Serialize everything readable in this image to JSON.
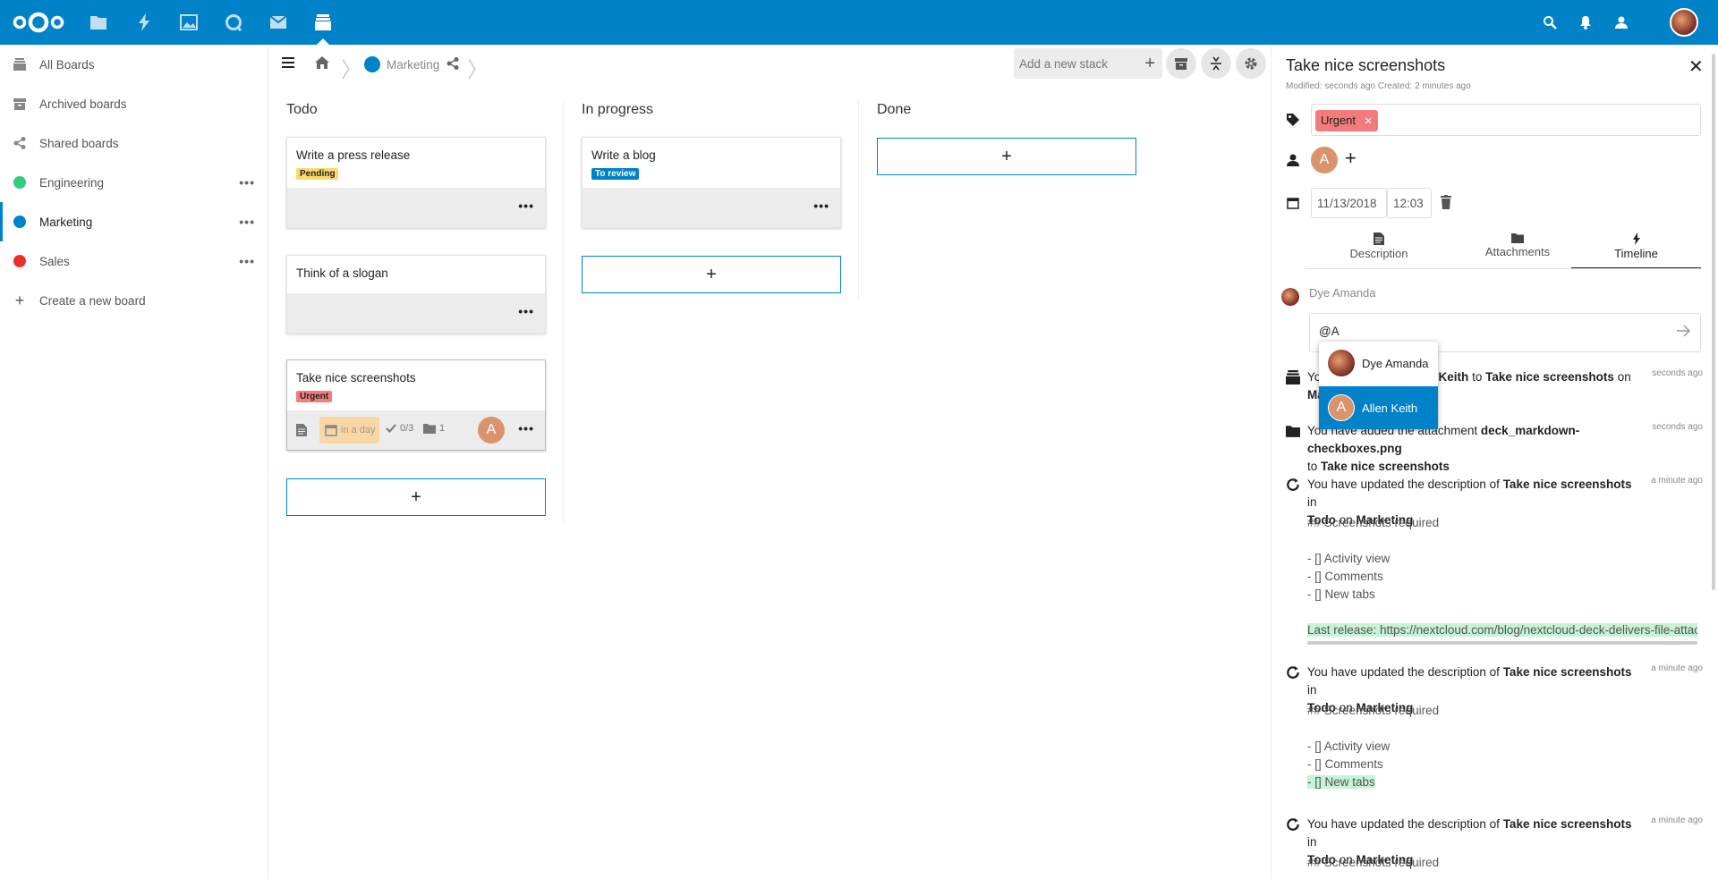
{
  "sidebar": {
    "items": [
      {
        "label": "All Boards"
      },
      {
        "label": "Archived boards"
      },
      {
        "label": "Shared boards"
      },
      {
        "label": "Engineering",
        "color": "#31cc7c"
      },
      {
        "label": "Marketing",
        "color": "#0082c9"
      },
      {
        "label": "Sales",
        "color": "#e9322d"
      },
      {
        "label": "Create a new board"
      }
    ]
  },
  "board": {
    "name": "Marketing",
    "color": "#0082c9",
    "add_stack_placeholder": "Add a new stack"
  },
  "stacks": [
    {
      "title": "Todo",
      "cards": [
        {
          "title": "Write a press release",
          "label": "Pending",
          "label_color": "#fbd96e"
        },
        {
          "title": "Think of a slogan"
        },
        {
          "title": "Take nice screenshots",
          "label": "Urgent",
          "label_color": "#f27b7b",
          "due": "in a day",
          "checklist": "0/3",
          "attachments": "1",
          "assignee": "A"
        }
      ]
    },
    {
      "title": "In progress",
      "cards": [
        {
          "title": "Write a blog",
          "label": "To review",
          "label_color": "#0082c9"
        }
      ]
    },
    {
      "title": "Done",
      "cards": []
    }
  ],
  "detail": {
    "title": "Take nice screenshots",
    "meta": "Modified: seconds ago Created: 2 minutes ago",
    "tag": "Urgent",
    "assignee_initial": "A",
    "due_date": "11/13/2018",
    "due_time": "12:03",
    "tabs": [
      {
        "label": "Description"
      },
      {
        "label": "Attachments"
      },
      {
        "label": "Timeline"
      }
    ],
    "comment_author": "Dye Amanda",
    "comment_value": "@A",
    "mention_options": [
      {
        "name": "Dye Amanda"
      },
      {
        "name": "Allen Keith",
        "initial": "A"
      }
    ],
    "activity": {
      "a1": {
        "you": "Yo",
        "rest1": "len Keith",
        "to": "to",
        "card": "Take nice screenshots",
        "on": "on",
        "line2": "Ma",
        "time": "seconds ago"
      },
      "a2": {
        "pre": "You have added the attachment",
        "file": "deck_markdown-checkboxes.png",
        "to": "to",
        "card": "Take nice screenshots",
        "time": "seconds ago"
      },
      "a3": {
        "pre": "You have updated the description of",
        "card": "Take nice screenshots",
        "in": "in",
        "stack": "Todo",
        "on": "on",
        "board": "Marketing",
        "time": "a minute ago"
      },
      "a3_md": [
        "## Screenshots required",
        "- [] Activity view",
        "- [] Comments",
        "- [] New tabs",
        "Last release: https://nextcloud.com/blog/nextcloud-deck-delivers-file-attachm"
      ],
      "a4": {
        "pre": "You have updated the description of",
        "card": "Take nice screenshots",
        "in": "in",
        "stack": "Todo",
        "on": "on",
        "board": "Marketing",
        "time": "a minute ago"
      },
      "a4_md": [
        "## Screenshots required",
        "- [] Activity view",
        "- [] Comments",
        "- [] New tabs"
      ],
      "a5": {
        "pre": "You have updated the description of",
        "card": "Take nice screenshots",
        "in": "in",
        "stack": "Todo",
        "on": "on",
        "board": "Marketing",
        "time": "a minute ago"
      },
      "a5_md": [
        "## Screenshots required"
      ]
    }
  },
  "colors": {
    "brand": "#0082c9"
  }
}
